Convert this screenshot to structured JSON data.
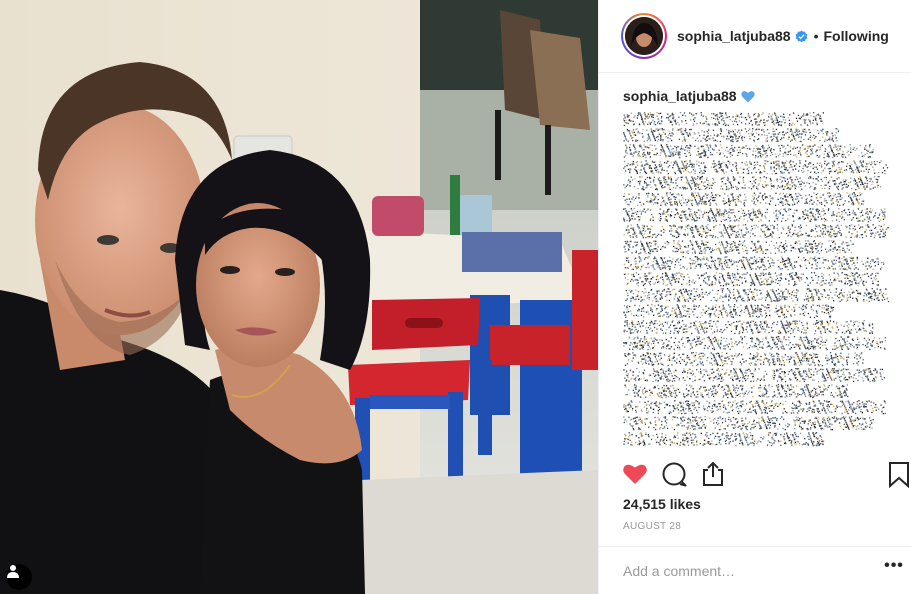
{
  "post": {
    "author": "sophia_latjuba88",
    "follow_separator": "•",
    "follow_state": "Following",
    "caption_author": "sophia_latjuba88",
    "likes_text": "24,515 likes",
    "date_text": "AUGUST 28"
  },
  "comment": {
    "placeholder": "Add a comment…",
    "more_label": "•••"
  },
  "icons": {
    "verified": "verified-badge-icon",
    "like": "heart-filled-icon",
    "comment": "speech-bubble-icon",
    "share": "share-icon",
    "save": "bookmark-icon",
    "user_tag": "person-tag-icon",
    "caption_emoji": "blue-heart-emoji-icon"
  },
  "colors": {
    "like_red": "#ed4956",
    "verified_blue": "#3897f0",
    "text": "#262626",
    "muted": "#999999",
    "divider": "#efefef"
  }
}
